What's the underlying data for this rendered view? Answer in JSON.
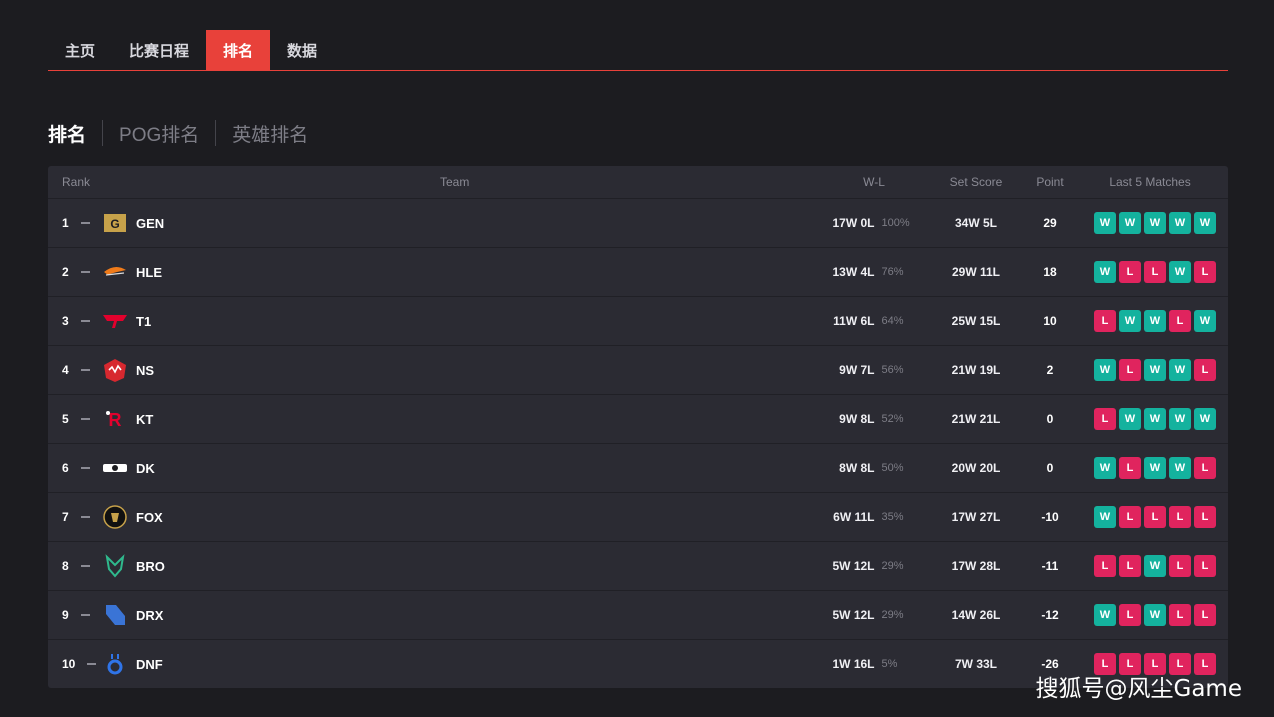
{
  "nav": {
    "tabs": [
      "主页",
      "比赛日程",
      "排名",
      "数据"
    ],
    "active": 2
  },
  "subtabs": [
    "排名",
    "POG排名",
    "英雄排名"
  ],
  "table": {
    "headers": {
      "rank": "Rank",
      "team": "Team",
      "wl": "W-L",
      "set": "Set Score",
      "point": "Point",
      "last5": "Last 5 Matches"
    },
    "rows": [
      {
        "rank": "1",
        "team": "GEN",
        "logo": "gen-logo",
        "wl": "17W 0L",
        "pct": "100%",
        "set": "34W 5L",
        "point": "29",
        "last5": [
          "W",
          "W",
          "W",
          "W",
          "W"
        ]
      },
      {
        "rank": "2",
        "team": "HLE",
        "logo": "hle-logo",
        "wl": "13W 4L",
        "pct": "76%",
        "set": "29W 11L",
        "point": "18",
        "last5": [
          "W",
          "L",
          "L",
          "W",
          "L"
        ]
      },
      {
        "rank": "3",
        "team": "T1",
        "logo": "t1-logo",
        "wl": "11W 6L",
        "pct": "64%",
        "set": "25W 15L",
        "point": "10",
        "last5": [
          "L",
          "W",
          "W",
          "L",
          "W"
        ]
      },
      {
        "rank": "4",
        "team": "NS",
        "logo": "ns-logo",
        "wl": "9W 7L",
        "pct": "56%",
        "set": "21W 19L",
        "point": "2",
        "last5": [
          "W",
          "L",
          "W",
          "W",
          "L"
        ]
      },
      {
        "rank": "5",
        "team": "KT",
        "logo": "kt-logo",
        "wl": "9W 8L",
        "pct": "52%",
        "set": "21W 21L",
        "point": "0",
        "last5": [
          "L",
          "W",
          "W",
          "W",
          "W"
        ]
      },
      {
        "rank": "6",
        "team": "DK",
        "logo": "dk-logo",
        "wl": "8W 8L",
        "pct": "50%",
        "set": "20W 20L",
        "point": "0",
        "last5": [
          "W",
          "L",
          "W",
          "W",
          "L"
        ]
      },
      {
        "rank": "7",
        "team": "FOX",
        "logo": "fox-logo",
        "wl": "6W 11L",
        "pct": "35%",
        "set": "17W 27L",
        "point": "-10",
        "last5": [
          "W",
          "L",
          "L",
          "L",
          "L"
        ]
      },
      {
        "rank": "8",
        "team": "BRO",
        "logo": "bro-logo",
        "wl": "5W 12L",
        "pct": "29%",
        "set": "17W 28L",
        "point": "-11",
        "last5": [
          "L",
          "L",
          "W",
          "L",
          "L"
        ]
      },
      {
        "rank": "9",
        "team": "DRX",
        "logo": "drx-logo",
        "wl": "5W 12L",
        "pct": "29%",
        "set": "14W 26L",
        "point": "-12",
        "last5": [
          "W",
          "L",
          "W",
          "L",
          "L"
        ]
      },
      {
        "rank": "10",
        "team": "DNF",
        "logo": "dnf-logo",
        "wl": "1W 16L",
        "pct": "5%",
        "set": "7W 33L",
        "point": "-26",
        "last5": [
          "L",
          "L",
          "L",
          "L",
          "L"
        ]
      }
    ]
  },
  "watermark": "搜狐号@风尘Game",
  "colors": {
    "accent": "#e8413a",
    "win": "#14b29e",
    "loss": "#e0245e"
  }
}
